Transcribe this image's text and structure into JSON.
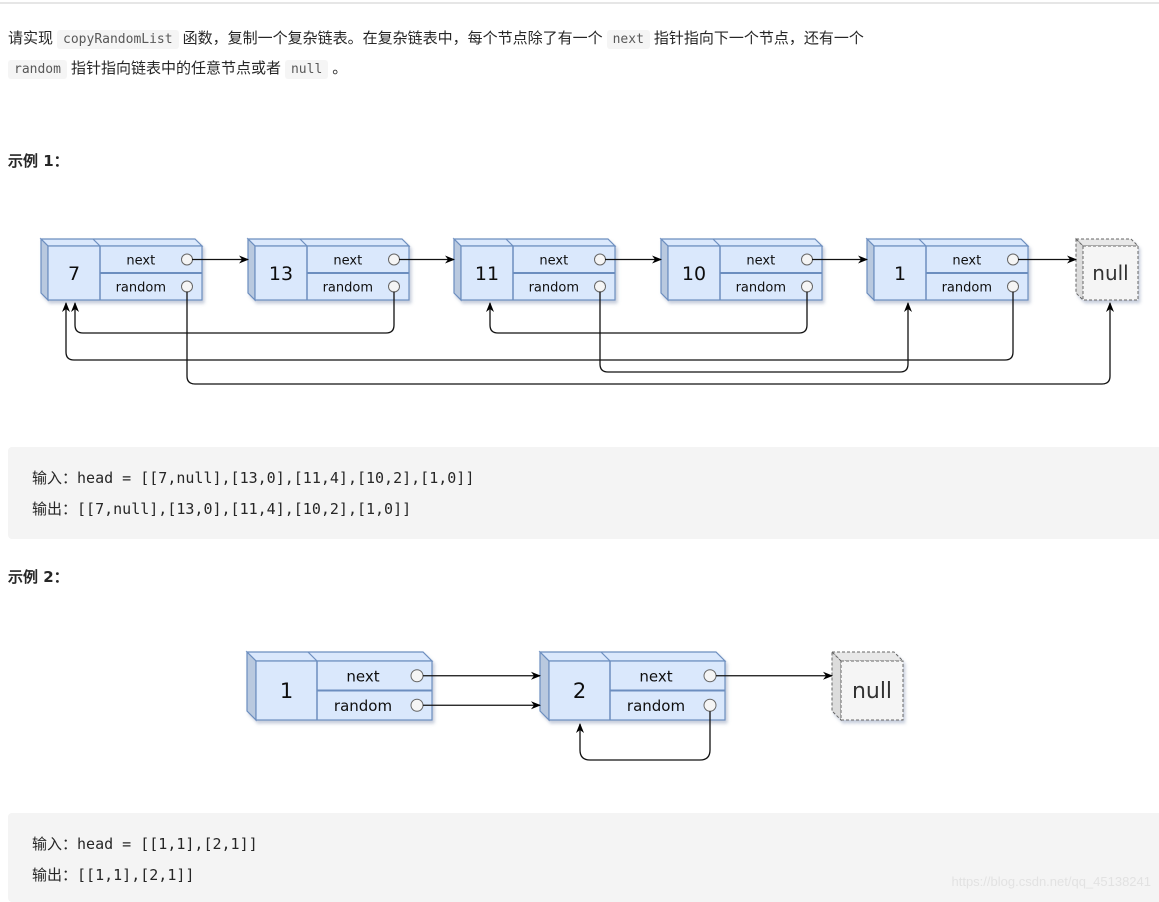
{
  "description": {
    "seg1": "请实现",
    "code1": "copyRandomList",
    "seg2": "函数，复制一个复杂链表。在复杂链表中，每个节点除了有一个",
    "code2": "next",
    "seg3": "指针指向下一个节点，还有一个",
    "code3": "random",
    "seg4": "指针指向链表中的任意节点或者",
    "code4": "null",
    "seg5": "。"
  },
  "examples": [
    {
      "heading": "示例 1：",
      "diagram": {
        "nodes": [
          {
            "value": "7",
            "next_label": "next",
            "random_label": "random",
            "random_target": "null"
          },
          {
            "value": "13",
            "next_label": "next",
            "random_label": "random",
            "random_target": 0
          },
          {
            "value": "11",
            "next_label": "next",
            "random_label": "random",
            "random_target": 4
          },
          {
            "value": "10",
            "next_label": "next",
            "random_label": "random",
            "random_target": 2
          },
          {
            "value": "1",
            "next_label": "next",
            "random_label": "random",
            "random_target": 0
          }
        ],
        "null_label": "null"
      },
      "input_label": "输入：",
      "input_value": "head = [[7,null],[13,0],[11,4],[10,2],[1,0]]",
      "output_label": "输出：",
      "output_value": "[[7,null],[13,0],[11,4],[10,2],[1,0]]"
    },
    {
      "heading": "示例 2：",
      "diagram": {
        "nodes": [
          {
            "value": "1",
            "next_label": "next",
            "random_label": "random",
            "random_target": 1
          },
          {
            "value": "2",
            "next_label": "next",
            "random_label": "random",
            "random_target": 1
          }
        ],
        "null_label": "null"
      },
      "input_label": "输入：",
      "input_value": "head = [[1,1],[2,1]]",
      "output_label": "输出：",
      "output_value": "[[1,1],[2,1]]"
    }
  ],
  "colors": {
    "node_fill": "#dae8fc",
    "node_stroke": "#6c8ebf",
    "node_side": "#b9c9df",
    "null_fill": "#f5f5f5",
    "null_stroke": "#666666",
    "code_bg": "#f4f4f4"
  },
  "watermark": "https://blog.csdn.net/qq_45138241"
}
